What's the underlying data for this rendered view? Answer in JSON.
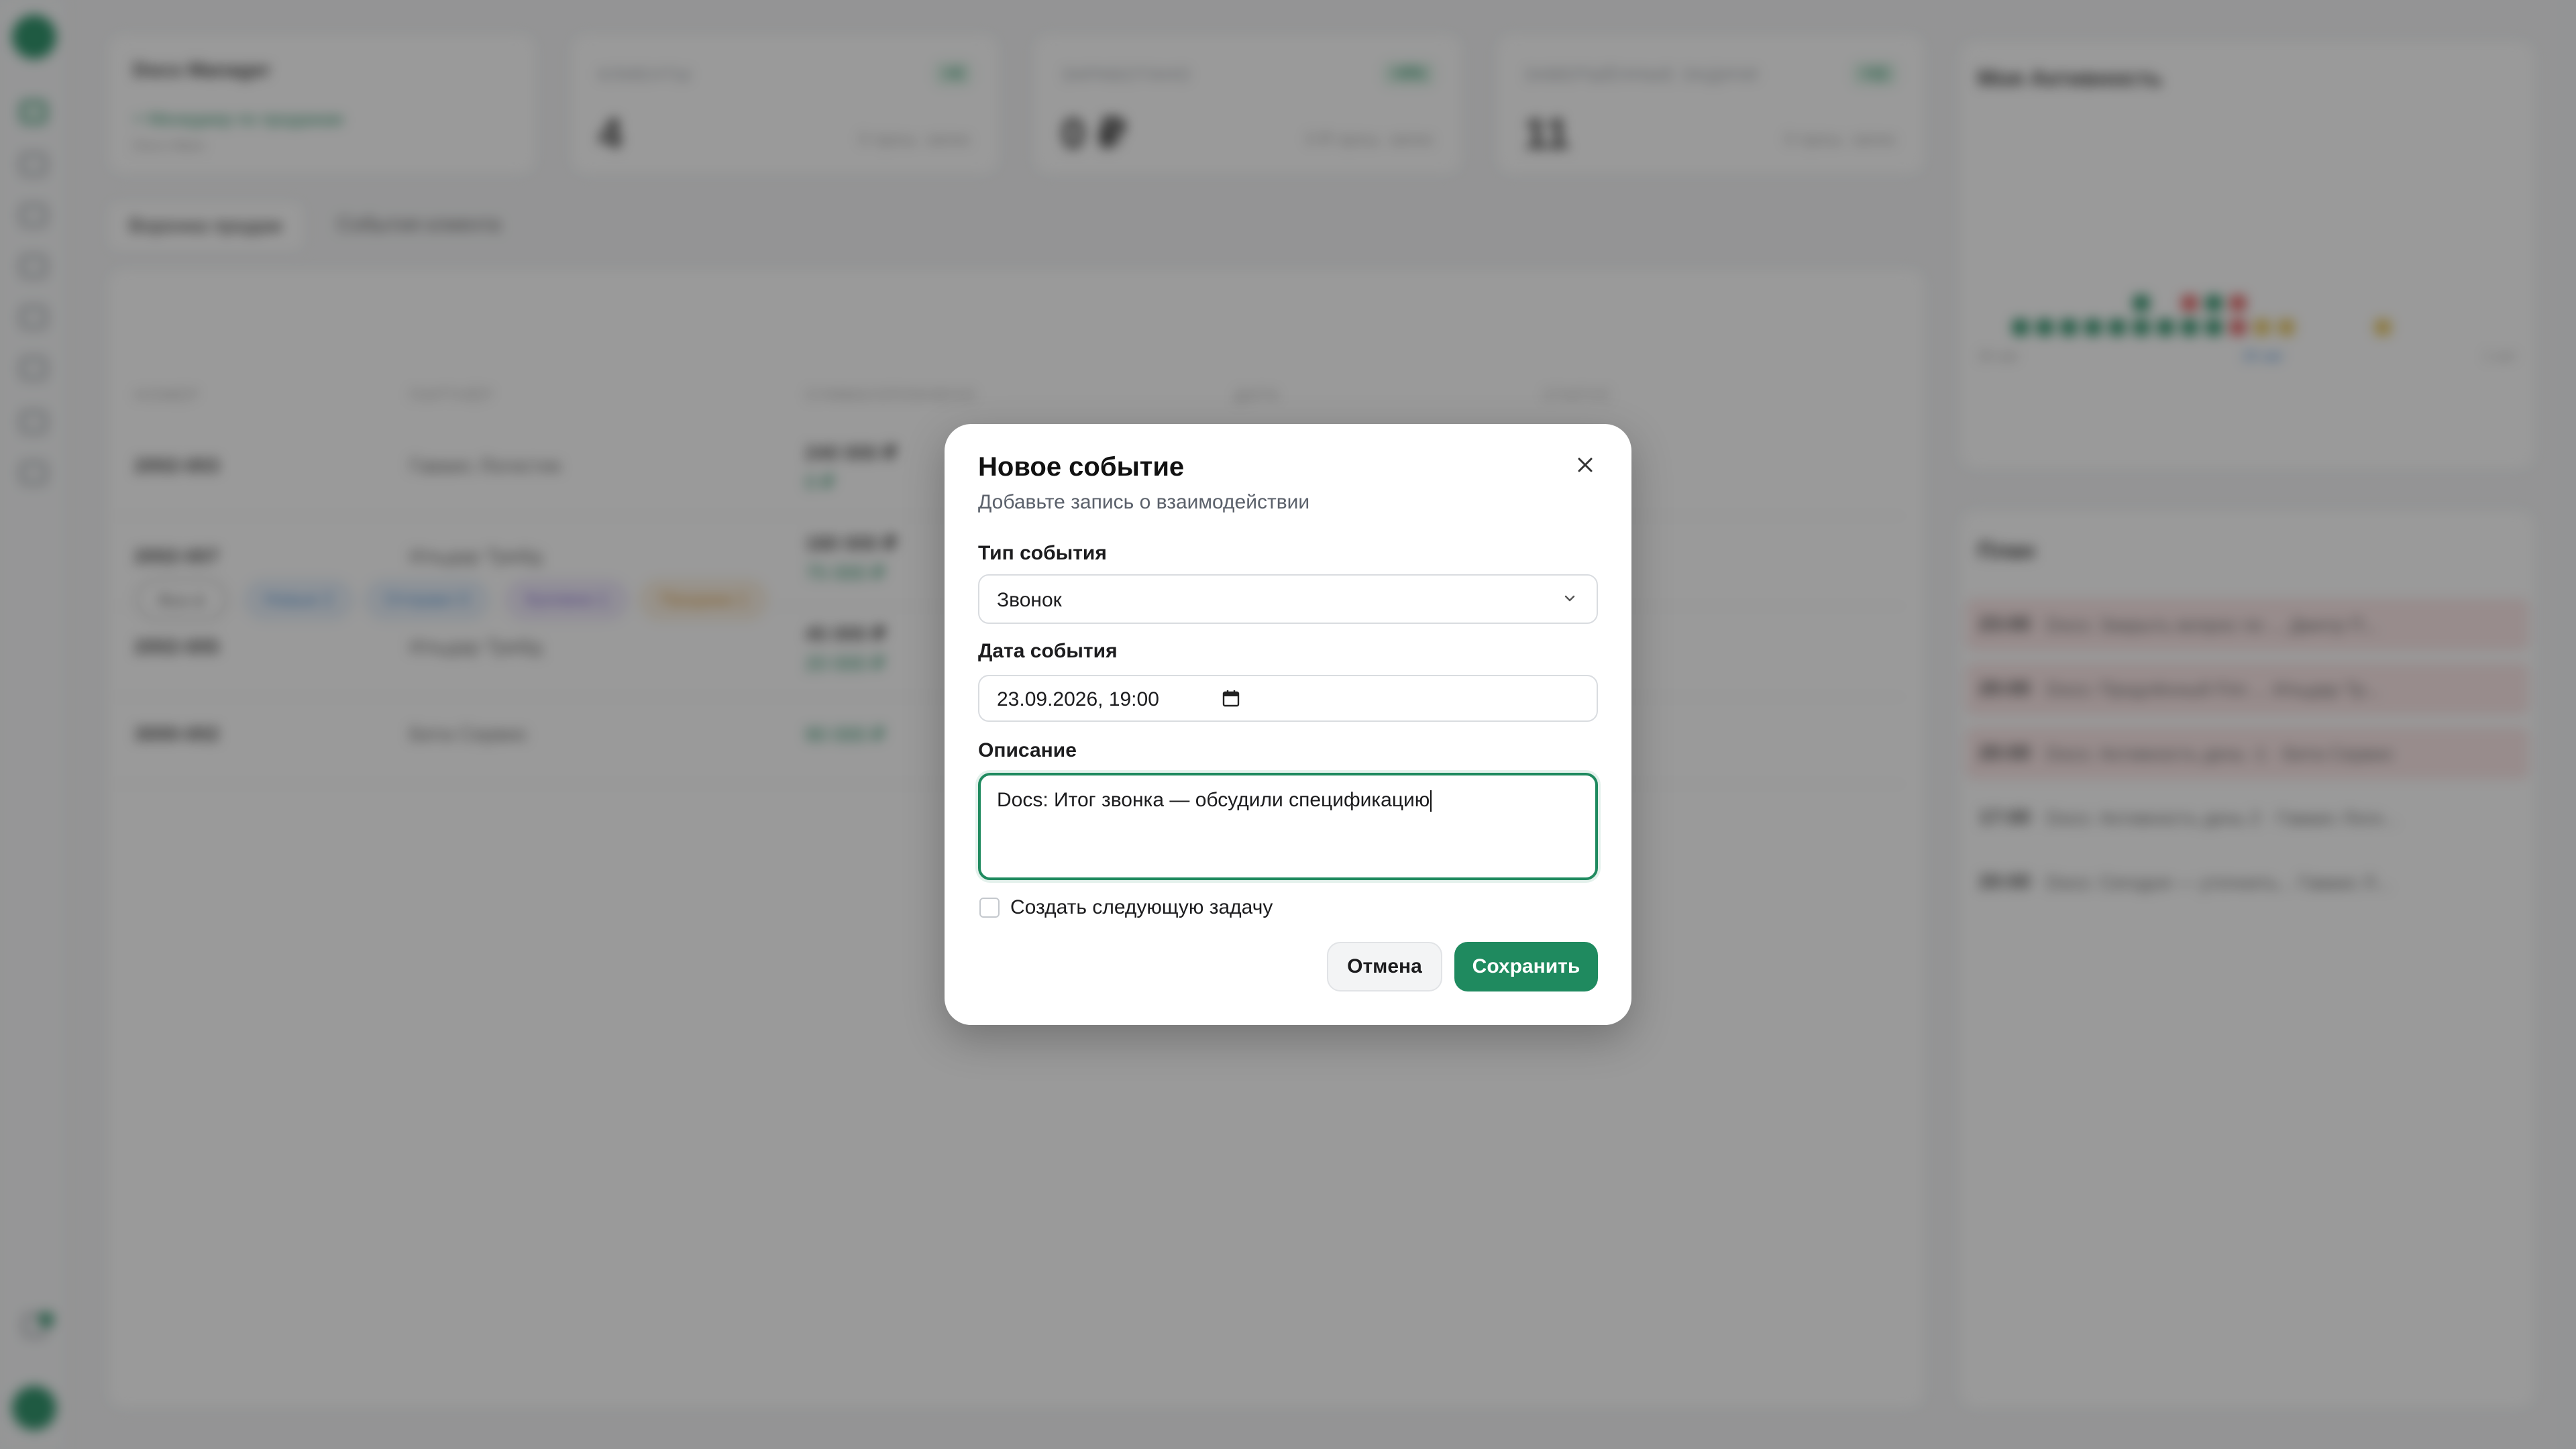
{
  "background": {
    "sidebar_card": {
      "title": "Docs Manager",
      "link": "+ Менеджер по продажам",
      "sub": "Docs Ивен"
    },
    "kpis": [
      {
        "label": "КЛИЕНТЫ",
        "badge": "+4",
        "value": "4",
        "sub": "0 прош. запис"
      },
      {
        "label": "ЗАРАБОТАНО",
        "badge": "+0%",
        "value": "0 ₽",
        "sub": "0 ₽ прош. запис"
      },
      {
        "label": "ЗАВЕРШЁННЫЕ ЗАДАЧИ",
        "badge": "+11",
        "value": "11",
        "sub": "0 прош. запис"
      }
    ],
    "tabs": [
      "Воронка продаж",
      "События клиента"
    ],
    "filters": [
      "Все 4",
      "Новые 2",
      "Отправл 0",
      "Куплено 1",
      "Продажа 1"
    ],
    "columns": [
      "НОМЕР",
      "ПАРТНЁР",
      "СУММА/ОПЛАЧЕНО",
      "ДАТА",
      "СТАТУС"
    ],
    "rows": [
      {
        "num": "2002-003",
        "partner": "Гаваис Логистик",
        "sum": "240 000 ₽",
        "paid": "0 ₽"
      },
      {
        "num": "2002-007",
        "partner": "Ильдар Трейд",
        "sum": "180 000 ₽",
        "paid": "75 000 ₽"
      },
      {
        "num": "2002-005",
        "partner": "Ильдар Трейд",
        "sum": "45 000 ₽",
        "paid": "20 000 ₽"
      },
      {
        "num": "3000-002",
        "partner": "Бета Сервис",
        "sum": "",
        "paid": "90 000 ₽"
      }
    ],
    "activity": {
      "title": "Моя Активность",
      "labels": [
        "26 авг",
        "26 авг",
        "1 окт"
      ]
    },
    "plans": {
      "title": "План",
      "items": [
        {
          "time": "23:00",
          "text": "Docs: Закрыть вопрос по ... Дмитр П..."
        },
        {
          "time": "20:00",
          "text": "Docs: Продлённый Fim ... Ильдар Тр..."
        },
        {
          "time": "20:00",
          "text": "Docs: Активность день -1 · Бета Сервис"
        },
        {
          "time": "17:00",
          "text": "Docs: Активность день 2 · Гаваис Логи..."
        },
        {
          "time": "20:00",
          "text": "Docs: Сегодня — уточнить... Гаваис Л..."
        }
      ]
    }
  },
  "modal": {
    "title": "Новое событие",
    "subtitle": "Добавьте запись о взаимодействии",
    "event_type": {
      "label": "Тип события",
      "value": "Звонок"
    },
    "event_date": {
      "label": "Дата события",
      "value": "23.09.2026, 19:00"
    },
    "description": {
      "label": "Описание",
      "value": "Docs: Итог звонка — обсудили спецификацию"
    },
    "next_task": {
      "label": "Создать следующую задачу",
      "checked": false
    },
    "buttons": {
      "cancel": "Отмена",
      "save": "Сохранить"
    }
  },
  "colors": {
    "accent": "#1f8a5f",
    "overlay": "rgba(30,30,30,0.45)"
  }
}
